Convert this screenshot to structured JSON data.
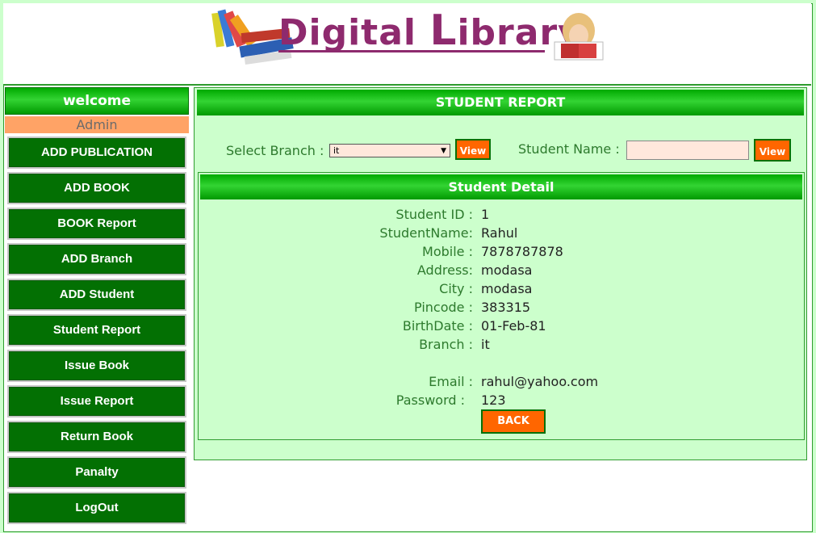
{
  "header": {
    "logo_word1": "Digital",
    "logo_word2_initial": "L",
    "logo_word2_rest": "ibrary"
  },
  "sidebar": {
    "welcome": "welcome",
    "user": "Admin",
    "items": [
      {
        "label": "ADD PUBLICATION"
      },
      {
        "label": "ADD BOOK"
      },
      {
        "label": "BOOK Report"
      },
      {
        "label": "ADD Branch"
      },
      {
        "label": "ADD Student"
      },
      {
        "label": "Student Report"
      },
      {
        "label": "Issue Book"
      },
      {
        "label": "Issue Report"
      },
      {
        "label": "Return Book"
      },
      {
        "label": "Panalty"
      },
      {
        "label": "LogOut"
      }
    ]
  },
  "main": {
    "title": "STUDENT REPORT",
    "branch_label": "Select Branch :",
    "branch_value": "it",
    "view_label": "View",
    "student_name_label": "Student Name :",
    "student_name_value": "",
    "detail": {
      "title": "Student Detail",
      "fields": [
        {
          "key": "Student ID :",
          "value": "1"
        },
        {
          "key": "StudentName:",
          "value": "Rahul"
        },
        {
          "key": "Mobile :",
          "value": "7878787878"
        },
        {
          "key": "Address:",
          "value": "modasa"
        },
        {
          "key": "City :",
          "value": "modasa"
        },
        {
          "key": "Pincode :",
          "value": "383315"
        },
        {
          "key": "BirthDate :",
          "value": "01-Feb-81"
        },
        {
          "key": "Branch :",
          "value": "it"
        },
        {
          "key": "Email :",
          "value": "rahul@yahoo.com"
        },
        {
          "key": "Password :",
          "value": "123"
        }
      ],
      "back_label": "BACK"
    }
  },
  "colors": {
    "accent_green": "#009900",
    "button_orange": "#ff6600",
    "sidebar_button": "#037003",
    "background": "#ccffcc"
  }
}
